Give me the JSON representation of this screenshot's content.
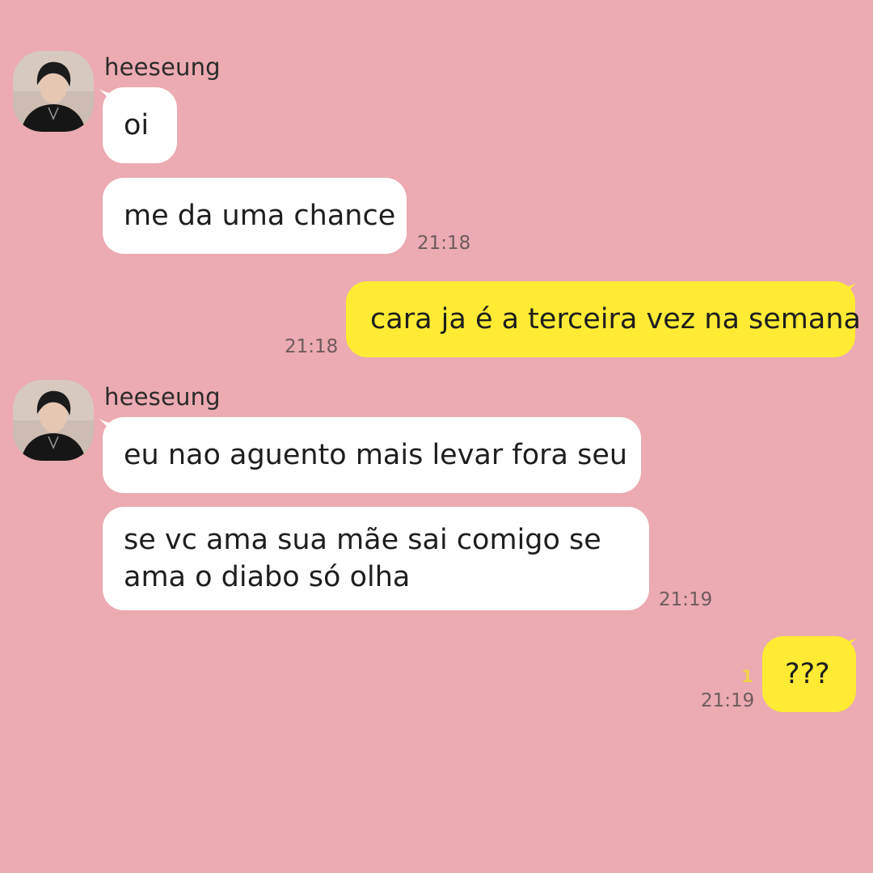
{
  "chat": {
    "groups": [
      {
        "sender": "heeseung",
        "messages": [
          {
            "text": "oi"
          },
          {
            "text": "me da uma chance",
            "time": "21:18"
          }
        ]
      },
      {
        "outgoing": true,
        "messages": [
          {
            "text": "cara ja é a terceira vez na semana",
            "time": "21:18"
          }
        ]
      },
      {
        "sender": "heeseung",
        "messages": [
          {
            "text": "eu nao aguento mais levar fora seu"
          },
          {
            "text": "se vc ama sua mãe sai comigo se ama o diabo só olha",
            "time": "21:19"
          }
        ]
      },
      {
        "outgoing": true,
        "messages": [
          {
            "text": "???",
            "time": "21:19",
            "unread": "1"
          }
        ]
      }
    ]
  },
  "colors": {
    "background": "#ECAAB2",
    "incoming_bubble": "#FFFFFF",
    "outgoing_bubble": "#FFEB33",
    "timestamp": "#6e5b5e",
    "unread_count": "#f1d24a"
  },
  "icons": {
    "avatar": "profile-photo"
  }
}
